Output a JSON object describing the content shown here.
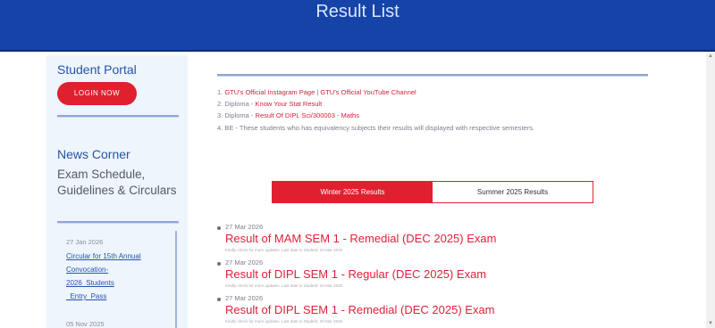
{
  "header": {
    "title": "Result List"
  },
  "sidebar": {
    "portal_title": "Student Portal",
    "login_label": "LOGIN NOW",
    "news_title": "News Corner",
    "news_subtitle": "Exam Schedule, Guidelines & Circulars",
    "news_items": [
      {
        "date": "27 Jan 2026",
        "lines": [
          "Circular for 15th Annual",
          "Convocation-",
          "2026_Students",
          "_Entry_Pass"
        ]
      },
      {
        "date": "05 Nov 2025"
      }
    ]
  },
  "notices": [
    {
      "num": "1",
      "pre": "",
      "link": "GTU's Official Instagram Page",
      "sep": "  |  ",
      "link2": "GTU's Official YouTube Channel",
      "post": ""
    },
    {
      "num": "2",
      "pre": "Diploma - ",
      "link": "Know Your Stat Result",
      "sep": "",
      "link2": "",
      "post": ""
    },
    {
      "num": "3",
      "pre": "Diploma - ",
      "link": "Result Of DIPL Sci/300003 - Maths",
      "sep": "",
      "link2": "",
      "post": ""
    },
    {
      "num": "4",
      "pre": "BE - These students who has equivalency subjects their results will displayed with respective semesters.",
      "link": "",
      "sep": "",
      "link2": "",
      "post": ""
    }
  ],
  "tabs": [
    {
      "label": "Winter 2025 Results",
      "active": true
    },
    {
      "label": "Summer 2025 Results",
      "active": false
    }
  ],
  "results": [
    {
      "date": "27 Mar 2026",
      "title": "Result of MAM SEM 1 - Remedial (DEC 2025) Exam",
      "meta": "Kindly check for more updates. Last date to Student: 30 Mar 2026"
    },
    {
      "date": "27 Mar 2026",
      "title": "Result of DIPL SEM 1 - Regular (DEC 2025) Exam",
      "meta": "Kindly check for more updates. Last date to Student: 30 Mar 2026"
    },
    {
      "date": "27 Mar 2026",
      "title": "Result of DIPL SEM 1 - Remedial (DEC 2025) Exam",
      "meta": "Kindly check for more updates. Last date to Student: 30 Mar 2026"
    }
  ],
  "colors": {
    "header_blue": "#1543a8",
    "accent_red": "#e0202f",
    "link_blue": "#2753a6"
  }
}
